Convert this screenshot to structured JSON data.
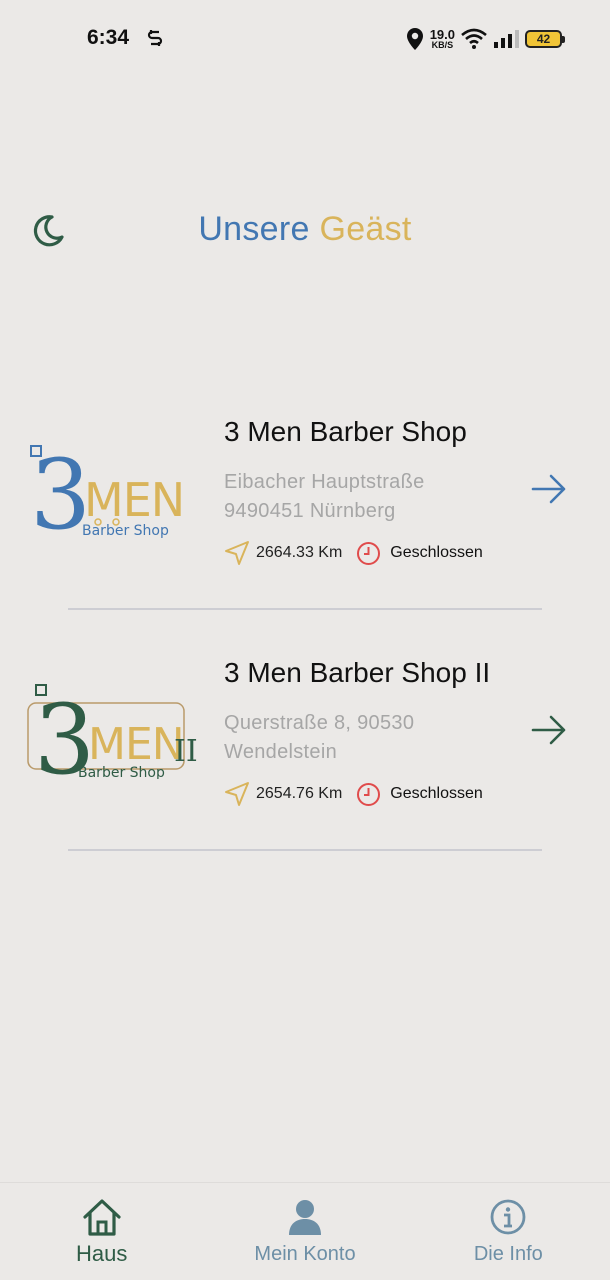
{
  "status_bar": {
    "time": "6:34",
    "speed_value": "19.0",
    "speed_unit": "KB/S",
    "battery": "42"
  },
  "header": {
    "title_part1": "Unsere",
    "title_part2": "Geäst",
    "theme_icon": "moon-icon",
    "colors": {
      "title_blue": "#4277b2",
      "title_gold": "#d9b45b",
      "accent_green": "#2f5c46"
    }
  },
  "shops": [
    {
      "name": "3 Men Barber Shop",
      "address_line1": "Eibacher Hauptstraße",
      "address_line2": "9490451 Nürnberg",
      "distance": "2664.33 Km",
      "status": "Geschlossen",
      "logo": {
        "numeral": "3",
        "word": "MEN",
        "tagline": "Barber Shop",
        "suffix": ""
      },
      "arrow_color": "#4277b2"
    },
    {
      "name": "3 Men Barber Shop II",
      "address_line1": "Querstraße 8, 90530",
      "address_line2": "Wendelstein",
      "distance": "2654.76 Km",
      "status": "Geschlossen",
      "logo": {
        "numeral": "3",
        "word": "MEN",
        "tagline": "Barber Shop",
        "suffix": "II"
      },
      "arrow_color": "#2f5c46"
    }
  ],
  "bottom_nav": {
    "items": [
      {
        "label": "Haus",
        "icon": "home-icon",
        "active": true
      },
      {
        "label": "Mein Konto",
        "icon": "user-icon",
        "active": false
      },
      {
        "label": "Die Info",
        "icon": "info-icon",
        "active": false
      }
    ]
  }
}
